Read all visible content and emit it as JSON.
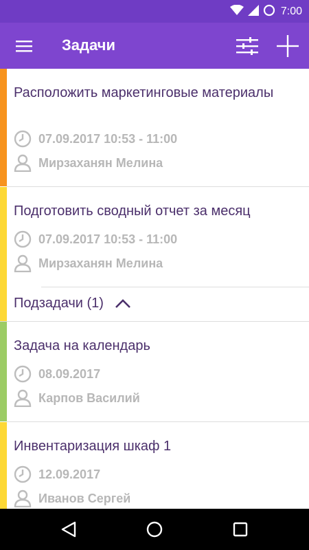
{
  "status_bar": {
    "time": "7:00"
  },
  "app_bar": {
    "title": "Задачи"
  },
  "tasks": [
    {
      "title": "Расположить маркетинговые материалы",
      "datetime": "07.09.2017 10:53 - 11:00",
      "assignee": "Мирзаханян Мелина",
      "accent": "#f7931e"
    },
    {
      "title": "Подготовить сводный отчет за месяц",
      "datetime": "07.09.2017 10:53 - 11:00",
      "assignee": "Мирзаханян Мелина",
      "accent": "#fdd835"
    },
    {
      "title": "Задача на календарь",
      "datetime": "08.09.2017",
      "assignee": "Карпов Василий",
      "accent": "#9ccc65"
    },
    {
      "title": "Инвентаризация шкаф 1",
      "datetime": "12.09.2017",
      "assignee": "Иванов Сергей",
      "accent": "#fdd835"
    }
  ],
  "subtasks": {
    "label": "Подзадачи (1)"
  },
  "colors": {
    "status_bar": "#6f3cc4",
    "app_bar": "#7e45cf",
    "title_text": "#4b2f6b",
    "meta_text": "#b7b7b7"
  }
}
